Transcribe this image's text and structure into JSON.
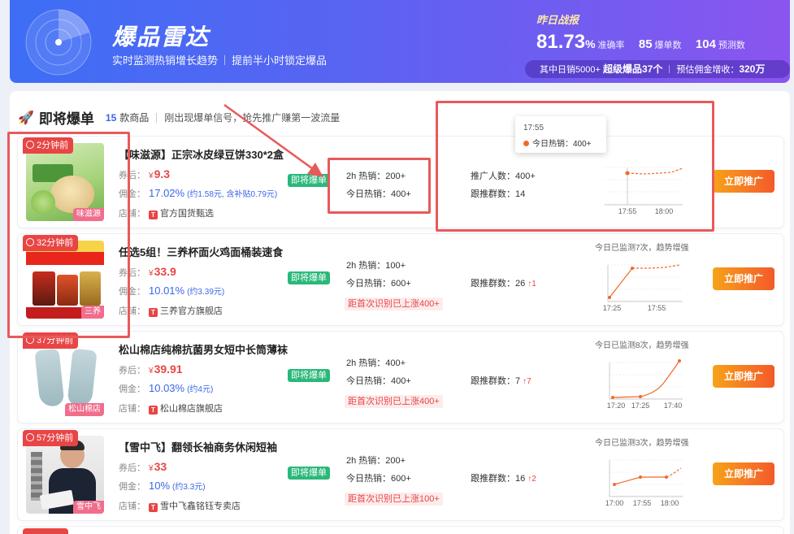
{
  "banner": {
    "title": "爆品雷达",
    "subtitle_1": "实时监测热销增长趋势",
    "subtitle_2": "提前半小时锁定爆品",
    "stats_label": "昨日战报",
    "accuracy_value": "81.73",
    "accuracy_unit": "%",
    "accuracy_label": "准确率",
    "hit_value": "85",
    "hit_label": "爆单数",
    "predict_value": "104",
    "predict_label": "预测数",
    "bar_prefix": "其中日销5000+",
    "bar_highlight": "超级爆品37个",
    "bar_income_label": "预估佣金增收：",
    "bar_income_value": "320万"
  },
  "section": {
    "title": "即将爆单",
    "count": "15",
    "count_label": "款商品",
    "description": "刚出现爆单信号，抢先推广赚第一波流量"
  },
  "labels": {
    "coupon": "券后：",
    "commission": "佣金：",
    "shop": "店铺：",
    "hot_badge": "即将爆单",
    "promote_button": "立即推广",
    "sales_2h": "2h 热销：",
    "sales_today": "今日热销：",
    "promoters": "推广人数：",
    "groups": "跟推群数：",
    "currency": "¥"
  },
  "tooltip": {
    "time": "17:55",
    "label": "今日热销：",
    "value": "400+"
  },
  "colors": {
    "accent_blue": "#3a67e8",
    "price_red": "#e84545",
    "badge_green": "#2ab87a",
    "button_orange": "#f5841f",
    "highlight_red": "#e85a5a"
  },
  "products": [
    {
      "time_tag": "2分钟前",
      "brand_tag": "味滋源",
      "title": "【味滋源】正宗冰皮绿豆饼330*2盒",
      "price": "9.3",
      "commission": "17.02%",
      "commission_detail": "(约1.58元, 含补贴0.79元)",
      "shop_icon": "T",
      "shop": "官方国货甄选",
      "sales_2h": "200+",
      "sales_today": "400+",
      "promoters": "400+",
      "groups": "14",
      "chart_caption": "",
      "chart_ticks": [
        "17:55",
        "18:00"
      ]
    },
    {
      "time_tag": "32分钟前",
      "brand_tag": "三养",
      "title": "任选5组！三养杯面火鸡面桶装速食",
      "price": "33.9",
      "commission": "10.01%",
      "commission_detail": "(约3.39元)",
      "shop_icon": "T",
      "shop": "三养官方旗舰店",
      "sales_2h": "100+",
      "sales_today": "600+",
      "rise_note": "距首次识别已上涨400+",
      "groups": "26",
      "groups_up": "↑1",
      "chart_caption": "今日已监测7次，趋势增强",
      "chart_ticks": [
        "17:25",
        "17:55"
      ]
    },
    {
      "time_tag": "37分钟前",
      "brand_tag": "松山棉店",
      "title": "松山棉店纯棉抗菌男女短中长筒薄袜",
      "price": "39.91",
      "commission": "10.03%",
      "commission_detail": "(约4元)",
      "shop_icon": "T",
      "shop": "松山棉店旗舰店",
      "sales_2h": "400+",
      "sales_today": "400+",
      "rise_note": "距首次识别已上涨400+",
      "groups": "7",
      "groups_up": "↑7",
      "chart_caption": "今日已监测8次，趋势增强",
      "chart_ticks": [
        "17:20",
        "17:25",
        "17:40"
      ]
    },
    {
      "time_tag": "57分钟前",
      "brand_tag": "雪中飞",
      "title": "【雪中飞】翻领长袖商务休闲短袖",
      "price": "33",
      "commission": "10%",
      "commission_detail": "(约3.3元)",
      "shop_icon": "T",
      "shop": "雪中飞鑫铭钰专卖店",
      "sales_2h": "200+",
      "sales_today": "600+",
      "rise_note": "距首次识别已上涨100+",
      "groups": "16",
      "groups_up": "↑2",
      "chart_caption": "今日已监测3次，趋势增强",
      "chart_ticks": [
        "17:00",
        "17:55",
        "18:00"
      ]
    }
  ]
}
